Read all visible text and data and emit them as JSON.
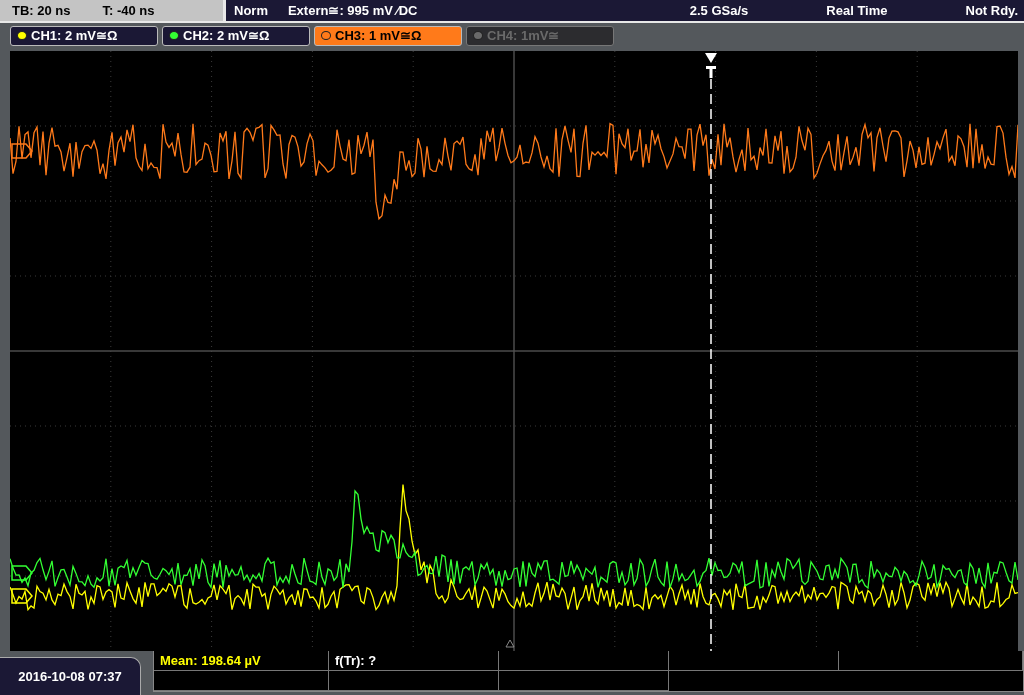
{
  "top_bar": {
    "timebase": "TB: 20 ns",
    "trigger_offset": "T: -40 ns",
    "trigger_mode": "Norm",
    "trigger_source": "Extern≅: 995 mV ⁄DC",
    "sample_rate": "2.5 GSa/s",
    "acquisition_mode": "Real Time",
    "status": "Not Rdy."
  },
  "channels": [
    {
      "label": "CH1: 2 mV≅Ω",
      "color": "#ffff00",
      "selected": false,
      "on": true
    },
    {
      "label": "CH2: 2 mV≅Ω",
      "color": "#33ff33",
      "selected": false,
      "on": true
    },
    {
      "label": "CH3: 1 mV≅Ω",
      "color": "#ff7a1a",
      "selected": true,
      "on": true
    },
    {
      "label": "CH4: 1mV≅",
      "color": "#6a6a6a",
      "selected": false,
      "on": false
    }
  ],
  "measurements": [
    {
      "text": "Mean: 198.64 µV",
      "color": "#ffff00"
    },
    {
      "text": "f(Tr): ?",
      "color": "#ffffff"
    }
  ],
  "date_time": "2016-10-08 07:37"
}
